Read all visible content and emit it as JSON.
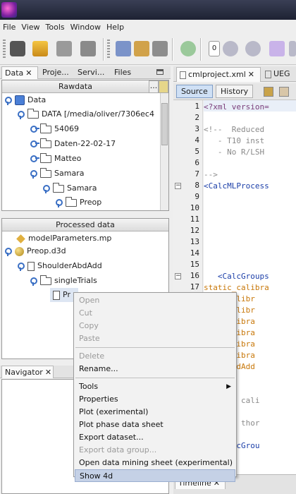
{
  "menubar": [
    "File",
    "View",
    "Tools",
    "Window",
    "Help"
  ],
  "toolbar": {
    "counter_value": "0"
  },
  "left_tabs": [
    {
      "label": "Data",
      "closable": true
    },
    {
      "label": "Proje...",
      "closable": false
    },
    {
      "label": "Servi...",
      "closable": false
    },
    {
      "label": "Files",
      "closable": false
    }
  ],
  "rawdata": {
    "header": "Rawdata",
    "more": "...",
    "tree": [
      {
        "label": "Data",
        "icon": "database"
      },
      {
        "label": "DATA [/media/oliver/7306ec4",
        "icon": "folder"
      },
      {
        "label": "54069",
        "icon": "folder"
      },
      {
        "label": "Daten-22-02-17",
        "icon": "folder"
      },
      {
        "label": "Matteo",
        "icon": "folder"
      },
      {
        "label": "Samara",
        "icon": "folder"
      },
      {
        "label": "Samara",
        "icon": "folder"
      },
      {
        "label": "Preop",
        "icon": "folder"
      }
    ]
  },
  "processed": {
    "header": "Processed data",
    "tree": [
      {
        "label": "modelParameters.mp",
        "icon": "diamond"
      },
      {
        "label": "Preop.d3d",
        "icon": "globe"
      },
      {
        "label": "ShoulderAbdAdd",
        "icon": "doc"
      },
      {
        "label": "singleTrials",
        "icon": "folder"
      },
      {
        "label": "Pr",
        "icon": "doc"
      }
    ]
  },
  "navigator": {
    "label": "Navigator"
  },
  "editor": {
    "tabs": [
      {
        "label": "cmlproject.xml"
      },
      {
        "label": "UEG"
      }
    ],
    "source_label": "Source",
    "history_label": "History",
    "lines": [
      {
        "n": "1",
        "text": "<?xml version=",
        "color": "#7a3d7a"
      },
      {
        "n": "2",
        "text": "",
        "color": "#222"
      },
      {
        "n": "3",
        "text": "<!--  Reduced ",
        "color": "#8a8a8a"
      },
      {
        "n": "4",
        "text": "   - T10 inst",
        "color": "#8a8a8a"
      },
      {
        "n": "5",
        "text": "   - No R/LSH",
        "color": "#8a8a8a"
      },
      {
        "n": "6",
        "text": "",
        "color": "#222"
      },
      {
        "n": "7",
        "text": "-->",
        "color": "#8a8a8a"
      },
      {
        "n": "8",
        "text": "<CalcMLProcess",
        "color": "#1b3ea8"
      },
      {
        "n": "9",
        "text": "",
        "color": "#222"
      },
      {
        "n": "10",
        "text": "",
        "color": "#222"
      },
      {
        "n": "11",
        "text": "",
        "color": "#222"
      },
      {
        "n": "12",
        "text": "",
        "color": "#222"
      },
      {
        "n": "13",
        "text": "",
        "color": "#222"
      },
      {
        "n": "14",
        "text": "",
        "color": "#222"
      },
      {
        "n": "15",
        "text": "",
        "color": "#222"
      },
      {
        "n": "16",
        "text": "   <CalcGroups",
        "color": "#1b3ea8"
      },
      {
        "n": "17",
        "text": "static_calibra",
        "color": "#c8780a"
      },
      {
        "n": "",
        "text": "atic_calibr",
        "color": "#c8780a"
      },
      {
        "n": "",
        "text": "amic_calibr",
        "color": "#c8780a"
      },
      {
        "n": "",
        "text": "tic_calibra",
        "color": "#c8780a"
      },
      {
        "n": "",
        "text": "tic_calibra",
        "color": "#c8780a"
      },
      {
        "n": "",
        "text": "tic_calibra",
        "color": "#c8780a"
      },
      {
        "n": "",
        "text": "tic_calibra",
        "color": "#c8780a"
      },
      {
        "n": "",
        "text": "ulderAbdAdd",
        "color": "#c8780a"
      },
      {
        "n": "",
        "text": "",
        "color": "#222"
      },
      {
        "n": "",
        "text": "",
        "color": "#222"
      },
      {
        "n": "",
        "text": "   <!-- cali",
        "color": "#8a8a8a"
      },
      {
        "n": "",
        "text": "",
        "color": "#222"
      },
      {
        "n": "",
        "text": "   <!-- thor",
        "color": "#8a8a8a"
      },
      {
        "n": "",
        "text": "",
        "color": "#222"
      },
      {
        "n": "",
        "text": "   <CalcGrou",
        "color": "#1b3ea8"
      }
    ]
  },
  "timeline": {
    "label": "Timeline"
  },
  "context_menu": {
    "items": [
      {
        "label": "Open",
        "enabled": false
      },
      {
        "label": "Cut",
        "enabled": false
      },
      {
        "label": "Copy",
        "enabled": false
      },
      {
        "label": "Paste",
        "enabled": false
      },
      {
        "sep": true
      },
      {
        "label": "Delete",
        "enabled": false
      },
      {
        "label": "Rename...",
        "enabled": true
      },
      {
        "sep": true
      },
      {
        "label": "Tools",
        "enabled": true,
        "submenu": true
      },
      {
        "label": "Properties",
        "enabled": true
      },
      {
        "label": "Plot (exerimental)",
        "enabled": true
      },
      {
        "label": "Plot phase data sheet",
        "enabled": true
      },
      {
        "label": "Export dataset...",
        "enabled": true
      },
      {
        "label": "Export data group...",
        "enabled": false
      },
      {
        "label": "Open data mining sheet (experimental)",
        "enabled": true
      },
      {
        "label": "Show 4d",
        "enabled": true,
        "selected": true
      }
    ]
  }
}
